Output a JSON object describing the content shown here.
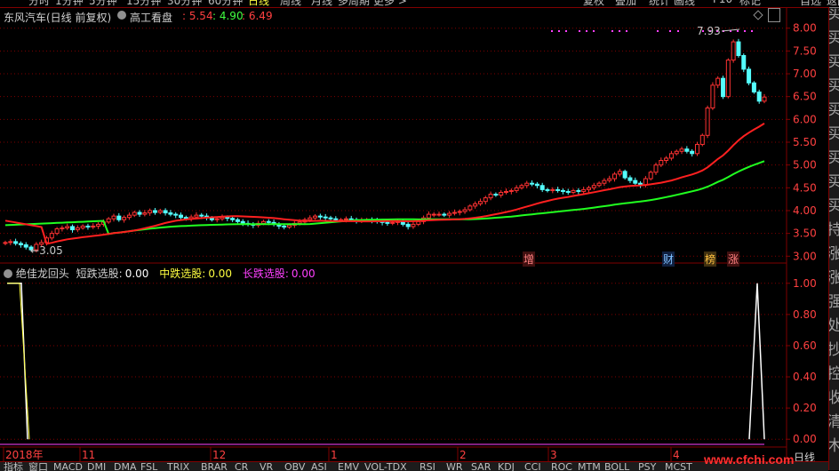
{
  "top_tabs": [
    "分时",
    "1分钟",
    "5分钟",
    "15分钟",
    "30分钟",
    "60分钟",
    "日线",
    "周线",
    "月线",
    "多周期",
    "更多 >",
    "复权",
    "叠加",
    "统计",
    "画线",
    "F10",
    "标记",
    "-",
    "自选",
    "返回"
  ],
  "main_panel": {
    "title": "东风汽车(日线 前复权)",
    "indicator": "高工看盘",
    "val1": "5.54",
    "val2": "4.90",
    "val3": "6.49",
    "high_label": "7.93",
    "low_label": "3.05",
    "markers": [
      "增",
      "财",
      "榜",
      "涨"
    ]
  },
  "sub_panel": {
    "name": "绝佳龙回头",
    "s1_label": "短跌选股:",
    "s1_value": "0.00",
    "s2_label": "中跌选股:",
    "s2_value": "0.00",
    "s3_label": "长跌选股:",
    "s3_value": "0.00"
  },
  "x_axis": [
    "2018年",
    "11",
    "12",
    "1",
    "2",
    "3",
    "4"
  ],
  "period_label": "日线",
  "bottom_tabs": [
    "指标",
    "窗口",
    "MACD",
    "DMI",
    "DMA",
    "FSL",
    "TRIX",
    "BRAR",
    "CR",
    "VR",
    "OBV",
    "ASI",
    "EMV",
    "VOL-TDX",
    "RSI",
    "WR",
    "SAR",
    "KDJ",
    "CCI",
    "ROC",
    "MTM",
    "BOLL",
    "PSY",
    "MCST"
  ],
  "right_bar": [
    "买",
    "买",
    "买",
    "买",
    "买",
    "买",
    "买",
    "买",
    "买",
    "持",
    "涨",
    "涨",
    "强",
    "处",
    "抄",
    "控",
    "收",
    "清",
    "木"
  ],
  "watermark": "www.cfchi.com",
  "colors": {
    "up": "#ff3232",
    "down": "#54ffff",
    "ma_short": "#ff2020",
    "ma_long": "#20ff20",
    "grid": "#800000",
    "axis_text": "#ff4040",
    "signal1": "#ffffff",
    "signal2": "#ffff40",
    "signal3": "#ff40ff"
  },
  "chart_data": [
    {
      "type": "candlestick",
      "title": "东风汽车(日线 前复权)",
      "y_ticks": [
        3.0,
        3.5,
        4.0,
        4.5,
        5.0,
        5.5,
        6.0,
        6.5,
        7.0,
        7.5,
        8.0
      ],
      "ylim": [
        2.85,
        8.15
      ],
      "x_ticks": [
        "2018年",
        "11",
        "12",
        "1",
        "2",
        "3",
        "4"
      ],
      "close": [
        3.3,
        3.32,
        3.28,
        3.25,
        3.2,
        3.14,
        3.26,
        3.3,
        3.4,
        3.5,
        3.6,
        3.62,
        3.65,
        3.58,
        3.62,
        3.66,
        3.64,
        3.66,
        3.7,
        3.75,
        3.82,
        3.88,
        3.8,
        3.85,
        3.9,
        3.96,
        3.92,
        3.95,
        4.0,
        3.96,
        4.0,
        3.95,
        3.92,
        3.9,
        3.85,
        3.82,
        3.86,
        3.9,
        3.88,
        3.84,
        3.8,
        3.82,
        3.85,
        3.83,
        3.8,
        3.76,
        3.72,
        3.7,
        3.68,
        3.72,
        3.76,
        3.74,
        3.7,
        3.66,
        3.64,
        3.68,
        3.72,
        3.75,
        3.8,
        3.84,
        3.88,
        3.86,
        3.84,
        3.82,
        3.8,
        3.8,
        3.82,
        3.8,
        3.78,
        3.79,
        3.8,
        3.78,
        3.76,
        3.74,
        3.72,
        3.74,
        3.76,
        3.7,
        3.65,
        3.7,
        3.76,
        3.84,
        3.92,
        3.92,
        3.92,
        3.9,
        3.94,
        3.96,
        3.98,
        4.02,
        4.1,
        4.15,
        4.2,
        4.28,
        4.36,
        4.34,
        4.4,
        4.42,
        4.44,
        4.5,
        4.55,
        4.6,
        4.58,
        4.55,
        4.46,
        4.44,
        4.46,
        4.44,
        4.42,
        4.4,
        4.44,
        4.42,
        4.46,
        4.5,
        4.55,
        4.6,
        4.66,
        4.7,
        4.8,
        4.86,
        4.72,
        4.66,
        4.6,
        4.56,
        4.7,
        4.84,
        5.0,
        5.1,
        5.15,
        5.25,
        5.3,
        5.35,
        5.3,
        5.25,
        5.45,
        5.65,
        6.25,
        6.75,
        6.9,
        6.5,
        7.3,
        7.7,
        7.4,
        7.1,
        6.8,
        6.6,
        6.4,
        6.49
      ],
      "high_label": 7.93,
      "low_label": 3.05
    },
    {
      "type": "line",
      "series": [
        {
          "name": "短跌选股",
          "values": [
            1,
            1,
            0,
            0,
            0,
            0,
            0,
            0,
            0,
            0,
            0,
            0,
            0,
            0,
            0,
            0,
            0,
            0,
            0,
            0,
            0,
            0,
            0,
            0,
            0,
            0,
            0,
            0,
            0,
            0,
            0,
            0,
            0,
            0,
            0,
            0,
            0,
            0,
            0,
            0,
            0,
            0,
            0,
            0,
            0,
            0,
            0,
            0,
            0,
            0,
            0,
            0,
            0,
            0,
            0,
            0,
            0,
            0,
            0,
            0,
            0,
            0,
            0,
            0,
            0,
            0,
            0,
            0,
            0,
            0,
            0,
            0,
            0,
            0,
            0,
            0,
            0,
            0,
            0,
            0,
            0,
            0,
            0,
            0,
            0,
            0,
            0,
            0,
            0,
            0,
            0,
            0,
            0,
            0,
            0,
            0,
            0,
            0,
            0,
            0,
            0,
            0,
            0,
            0,
            0,
            0,
            0,
            0,
            0,
            0,
            0,
            0,
            0,
            0,
            0,
            0,
            0,
            0,
            0,
            0,
            0,
            0,
            0,
            0,
            0,
            0,
            0,
            0,
            0,
            0,
            0,
            0,
            0,
            0,
            0,
            0,
            0,
            0,
            0,
            0,
            0,
            0,
            0,
            0,
            0,
            0,
            0,
            1,
            0,
            0
          ]
        },
        {
          "name": "中跌选股",
          "values": [
            1,
            0,
            0,
            0,
            0
          ]
        },
        {
          "name": "长跌选股",
          "values": [
            0,
            0,
            0,
            0,
            0
          ]
        }
      ],
      "y_ticks": [
        0.0,
        0.2,
        0.4,
        0.6,
        0.8,
        1.0
      ],
      "ylim": [
        -0.05,
        1.05
      ]
    }
  ]
}
